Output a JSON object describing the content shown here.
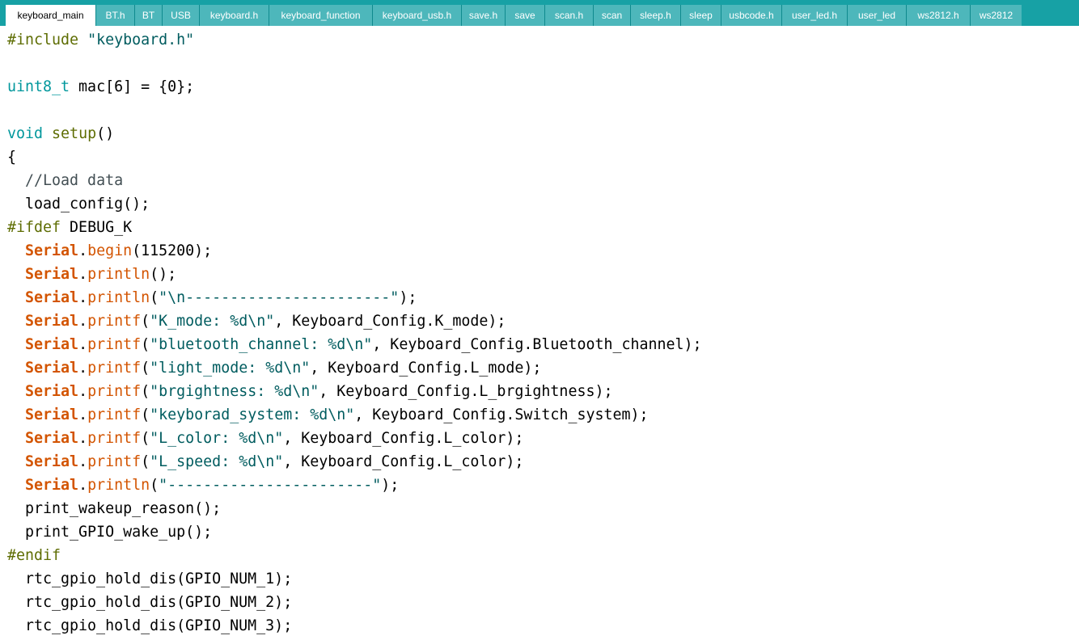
{
  "tabs": [
    {
      "label": "keyboard_main",
      "active": true
    },
    {
      "label": "BT.h",
      "active": false
    },
    {
      "label": "BT",
      "active": false
    },
    {
      "label": "USB",
      "active": false
    },
    {
      "label": "keyboard.h",
      "active": false
    },
    {
      "label": "keyboard_function",
      "active": false
    },
    {
      "label": "keyboard_usb.h",
      "active": false
    },
    {
      "label": "save.h",
      "active": false
    },
    {
      "label": "save",
      "active": false
    },
    {
      "label": "scan.h",
      "active": false
    },
    {
      "label": "scan",
      "active": false
    },
    {
      "label": "sleep.h",
      "active": false
    },
    {
      "label": "sleep",
      "active": false
    },
    {
      "label": "usbcode.h",
      "active": false
    },
    {
      "label": "user_led.h",
      "active": false
    },
    {
      "label": "user_led",
      "active": false
    },
    {
      "label": "ws2812.h",
      "active": false
    },
    {
      "label": "ws2812",
      "active": false
    }
  ],
  "code_lines": [
    [
      {
        "t": "#include ",
        "c": "pp"
      },
      {
        "t": "\"keyboard.h\"",
        "c": "str"
      }
    ],
    [],
    [
      {
        "t": "uint8_t",
        "c": "ty"
      },
      {
        "t": " mac[6] = {0};",
        "c": "def"
      }
    ],
    [],
    [
      {
        "t": "void",
        "c": "kw"
      },
      {
        "t": " ",
        "c": "def"
      },
      {
        "t": "setup",
        "c": "fnname"
      },
      {
        "t": "()",
        "c": "def"
      }
    ],
    [
      {
        "t": "{",
        "c": "def"
      }
    ],
    [
      {
        "t": "  ",
        "c": "def"
      },
      {
        "t": "//Load data",
        "c": "cm"
      }
    ],
    [
      {
        "t": "  load_config();",
        "c": "def"
      }
    ],
    [
      {
        "t": "#ifdef",
        "c": "pp"
      },
      {
        "t": " DEBUG_K",
        "c": "def"
      }
    ],
    [
      {
        "t": "  ",
        "c": "def"
      },
      {
        "t": "Serial",
        "c": "cls"
      },
      {
        "t": ".",
        "c": "def"
      },
      {
        "t": "begin",
        "c": "fn"
      },
      {
        "t": "(115200);",
        "c": "def"
      }
    ],
    [
      {
        "t": "  ",
        "c": "def"
      },
      {
        "t": "Serial",
        "c": "cls"
      },
      {
        "t": ".",
        "c": "def"
      },
      {
        "t": "println",
        "c": "fn"
      },
      {
        "t": "();",
        "c": "def"
      }
    ],
    [
      {
        "t": "  ",
        "c": "def"
      },
      {
        "t": "Serial",
        "c": "cls"
      },
      {
        "t": ".",
        "c": "def"
      },
      {
        "t": "println",
        "c": "fn"
      },
      {
        "t": "(",
        "c": "def"
      },
      {
        "t": "\"\\n-----------------------\"",
        "c": "str"
      },
      {
        "t": ");",
        "c": "def"
      }
    ],
    [
      {
        "t": "  ",
        "c": "def"
      },
      {
        "t": "Serial",
        "c": "cls"
      },
      {
        "t": ".",
        "c": "def"
      },
      {
        "t": "printf",
        "c": "fn"
      },
      {
        "t": "(",
        "c": "def"
      },
      {
        "t": "\"K_mode: %d\\n\"",
        "c": "str"
      },
      {
        "t": ", Keyboard_Config.K_mode);",
        "c": "def"
      }
    ],
    [
      {
        "t": "  ",
        "c": "def"
      },
      {
        "t": "Serial",
        "c": "cls"
      },
      {
        "t": ".",
        "c": "def"
      },
      {
        "t": "printf",
        "c": "fn"
      },
      {
        "t": "(",
        "c": "def"
      },
      {
        "t": "\"bluetooth_channel: %d\\n\"",
        "c": "str"
      },
      {
        "t": ", Keyboard_Config.Bluetooth_channel);",
        "c": "def"
      }
    ],
    [
      {
        "t": "  ",
        "c": "def"
      },
      {
        "t": "Serial",
        "c": "cls"
      },
      {
        "t": ".",
        "c": "def"
      },
      {
        "t": "printf",
        "c": "fn"
      },
      {
        "t": "(",
        "c": "def"
      },
      {
        "t": "\"light_mode: %d\\n\"",
        "c": "str"
      },
      {
        "t": ", Keyboard_Config.L_mode);",
        "c": "def"
      }
    ],
    [
      {
        "t": "  ",
        "c": "def"
      },
      {
        "t": "Serial",
        "c": "cls"
      },
      {
        "t": ".",
        "c": "def"
      },
      {
        "t": "printf",
        "c": "fn"
      },
      {
        "t": "(",
        "c": "def"
      },
      {
        "t": "\"brgightness: %d\\n\"",
        "c": "str"
      },
      {
        "t": ", Keyboard_Config.L_brgightness);",
        "c": "def"
      }
    ],
    [
      {
        "t": "  ",
        "c": "def"
      },
      {
        "t": "Serial",
        "c": "cls"
      },
      {
        "t": ".",
        "c": "def"
      },
      {
        "t": "printf",
        "c": "fn"
      },
      {
        "t": "(",
        "c": "def"
      },
      {
        "t": "\"keyborad_system: %d\\n\"",
        "c": "str"
      },
      {
        "t": ", Keyboard_Config.Switch_system);",
        "c": "def"
      }
    ],
    [
      {
        "t": "  ",
        "c": "def"
      },
      {
        "t": "Serial",
        "c": "cls"
      },
      {
        "t": ".",
        "c": "def"
      },
      {
        "t": "printf",
        "c": "fn"
      },
      {
        "t": "(",
        "c": "def"
      },
      {
        "t": "\"L_color: %d\\n\"",
        "c": "str"
      },
      {
        "t": ", Keyboard_Config.L_color);",
        "c": "def"
      }
    ],
    [
      {
        "t": "  ",
        "c": "def"
      },
      {
        "t": "Serial",
        "c": "cls"
      },
      {
        "t": ".",
        "c": "def"
      },
      {
        "t": "printf",
        "c": "fn"
      },
      {
        "t": "(",
        "c": "def"
      },
      {
        "t": "\"L_speed: %d\\n\"",
        "c": "str"
      },
      {
        "t": ", Keyboard_Config.L_color);",
        "c": "def"
      }
    ],
    [
      {
        "t": "  ",
        "c": "def"
      },
      {
        "t": "Serial",
        "c": "cls"
      },
      {
        "t": ".",
        "c": "def"
      },
      {
        "t": "println",
        "c": "fn"
      },
      {
        "t": "(",
        "c": "def"
      },
      {
        "t": "\"-----------------------\"",
        "c": "str"
      },
      {
        "t": ");",
        "c": "def"
      }
    ],
    [
      {
        "t": "  print_wakeup_reason();",
        "c": "def"
      }
    ],
    [
      {
        "t": "  print_GPIO_wake_up();",
        "c": "def"
      }
    ],
    [
      {
        "t": "#endif",
        "c": "pp"
      }
    ],
    [
      {
        "t": "  rtc_gpio_hold_dis(GPIO_NUM_1);",
        "c": "def"
      }
    ],
    [
      {
        "t": "  rtc_gpio_hold_dis(GPIO_NUM_2);",
        "c": "def"
      }
    ],
    [
      {
        "t": "  rtc_gpio_hold_dis(GPIO_NUM_3);",
        "c": "def"
      }
    ]
  ],
  "colors": {
    "tabbar": "#17a1a5",
    "tab_inactive": "#4db7bb",
    "tab_active": "#ffffff",
    "keyword": "#00979c",
    "class": "#d35400",
    "string": "#005c5f",
    "comment": "#434f54",
    "preprocessor": "#5e6d03"
  }
}
